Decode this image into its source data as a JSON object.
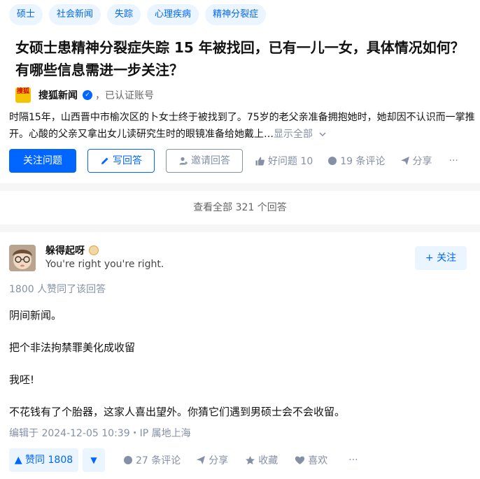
{
  "question": {
    "tags": [
      "硕士",
      "社会新闻",
      "失踪",
      "心理疾病",
      "精神分裂症"
    ],
    "title": "女硕士患精神分裂症失踪 15 年被找回，已有一儿一女，具体情况如何？有哪些信息需进一步关注？",
    "source_logo_text": "搜狐",
    "source_name": "搜狐新闻",
    "verified_text": "，已认证账号",
    "excerpt": "时隔15年，山西晋中市榆次区的卜女士终于被找到了。75岁的老父亲准备拥抱她时，她却因不认识而一掌推开。心酸的父亲又拿出女儿读研究生时的眼镜准备给她戴上…",
    "expand_label": "显示全部",
    "actions": {
      "follow": "关注问题",
      "write": "写回答",
      "invite": "邀请回答",
      "good_question": "好问题 10",
      "comments": "19 条评论",
      "share": "分享",
      "more": "···"
    }
  },
  "view_all_label": "查看全部 321 个回答",
  "answer": {
    "author_name": "躲得起呀",
    "author_headline": "You're right you're right.",
    "follow_label": "+ 关注",
    "upvoted_text": "1800 人赞同了该回答",
    "paragraphs": [
      "阴间新闻。",
      "把个非法拘禁罪美化成收留",
      "我呸!",
      "不花钱有了个胎器，这家人喜出望外。你猜它们遇到男硕士会不会收留。"
    ],
    "edited": "编辑于 2024-12-05 10:39・IP 属地上海",
    "actions": {
      "upvote": "▲ 赞同 1808",
      "downvote": "▼",
      "comments": "27 条评论",
      "share": "分享",
      "collect": "收藏",
      "like": "喜欢",
      "more": "···"
    }
  },
  "colors": {
    "brand_blue": "#0066ff",
    "light_blue": "#ebf5ff",
    "gray_text": "#8590a6"
  }
}
